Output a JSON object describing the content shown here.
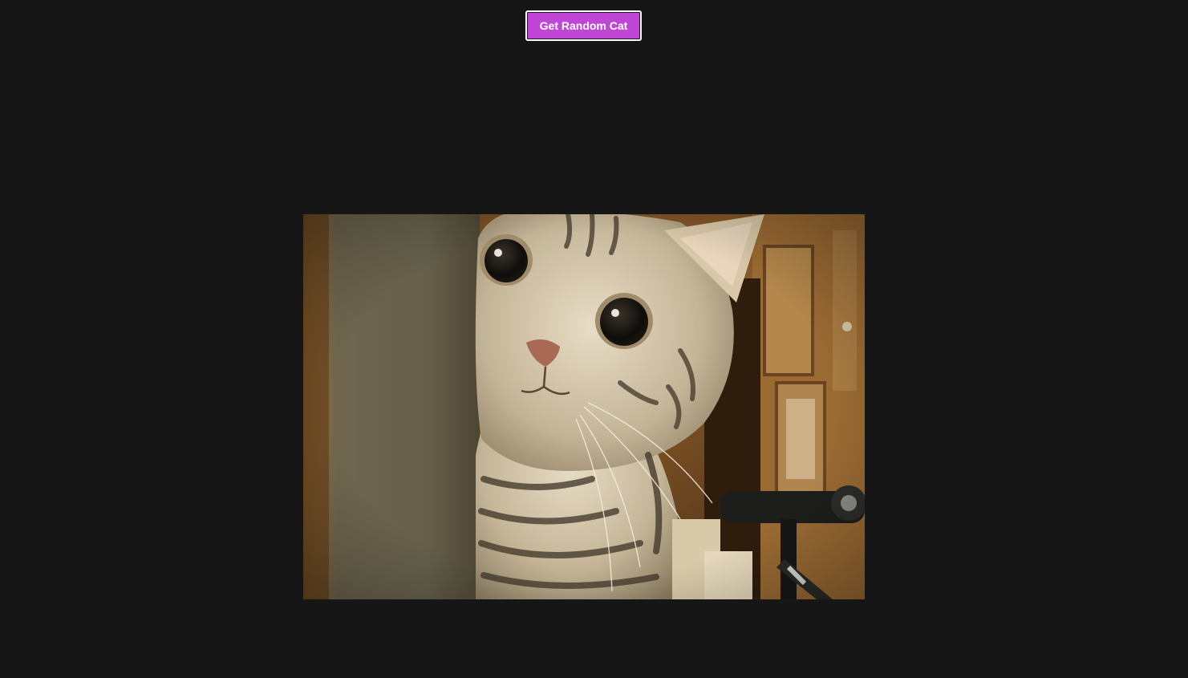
{
  "button": {
    "label": "Get Random Cat"
  },
  "image": {
    "subject": "tabby-kitten-peeking-photo"
  },
  "colors": {
    "background": "#161616",
    "button": "#c046d6",
    "button_text": "#ffffff"
  }
}
